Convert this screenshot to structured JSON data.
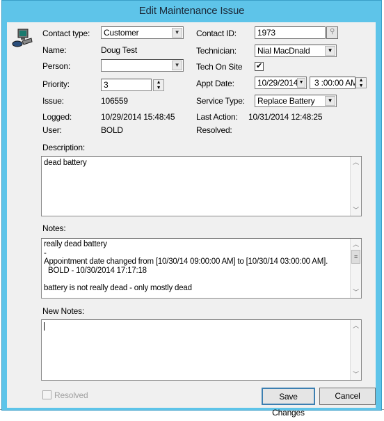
{
  "window": {
    "title": "Edit Maintenance Issue"
  },
  "form": {
    "contact_type": {
      "label": "Contact type:",
      "value": "Customer"
    },
    "name": {
      "label": "Name:",
      "value": "Doug Test"
    },
    "person": {
      "label": "Person:",
      "value": ""
    },
    "priority": {
      "label": "Priority:",
      "value": "3"
    },
    "issue": {
      "label": "Issue:",
      "value": "106559"
    },
    "logged": {
      "label": "Logged:",
      "value": "10/29/2014 15:48:45"
    },
    "user": {
      "label": "User:",
      "value": "BOLD"
    },
    "contact_id": {
      "label": "Contact ID:",
      "value": "1973"
    },
    "technician": {
      "label": "Technician:",
      "value": "Nial MacDnald"
    },
    "tech_on_site": {
      "label": "Tech On Site",
      "checked": true
    },
    "appt_date": {
      "label": "Appt Date:",
      "date": "10/29/2014",
      "time": "3 :00:00 AM"
    },
    "service_type": {
      "label": "Service Type:",
      "value": "Replace Battery"
    },
    "last_action": {
      "label": "Last Action:",
      "value": "10/31/2014 12:48:25"
    },
    "resolved": {
      "label": "Resolved:",
      "value": ""
    }
  },
  "description": {
    "label": "Description:",
    "value": "dead battery"
  },
  "notes": {
    "label": "Notes:",
    "lines": [
      "really dead battery",
      "-",
      "Appointment date changed from [10/30/14 09:00:00 AM] to [10/30/14 03:00:00 AM].",
      "  BOLD - 10/30/2014 17:17:18",
      "",
      "battery is not really dead - only mostly dead"
    ]
  },
  "new_notes": {
    "label": "New Notes:",
    "value": ""
  },
  "footer": {
    "resolved_checkbox": "Resolved",
    "resolved_checked": false,
    "save_label": "Save Changes",
    "cancel_label": "Cancel"
  }
}
